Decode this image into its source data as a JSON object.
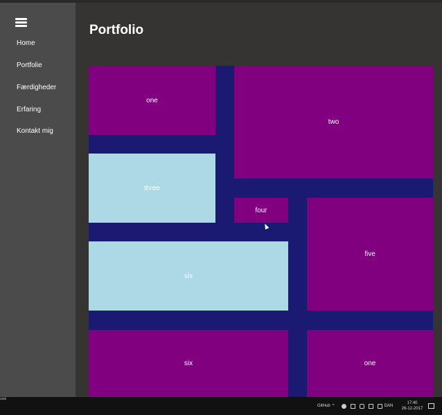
{
  "page": {
    "title": "Portfolio"
  },
  "sidebar": {
    "menu_icon": "hamburger-menu-icon",
    "items": [
      {
        "label": "Home"
      },
      {
        "label": "Portfolie"
      },
      {
        "label": "Færdigheder"
      },
      {
        "label": "Erfaring"
      },
      {
        "label": "Kontakt mig"
      }
    ]
  },
  "grid": {
    "colors": {
      "background": "#1a1a73",
      "purple": "#800080",
      "light_blue": "#add8e6"
    },
    "tiles": [
      {
        "label": "one",
        "color": "purple"
      },
      {
        "label": "two",
        "color": "purple"
      },
      {
        "label": "three",
        "color": "light_blue"
      },
      {
        "label": "four",
        "color": "purple"
      },
      {
        "label": "five",
        "color": "purple"
      },
      {
        "label": "six",
        "color": "light_blue"
      },
      {
        "label": "six",
        "color": "purple"
      },
      {
        "label": "one",
        "color": "purple"
      }
    ]
  },
  "taskbar": {
    "left_text": "stak",
    "github_label": "GitHub",
    "language": "DAN",
    "time": "17:40",
    "date": "26-12-2017"
  }
}
